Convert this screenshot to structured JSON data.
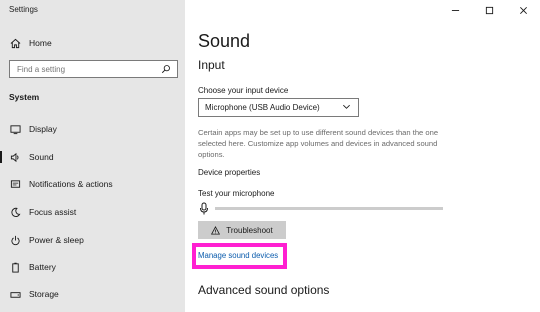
{
  "window": {
    "app_title": "Settings",
    "controls": [
      {
        "name": "minimize-icon"
      },
      {
        "name": "maximize-icon"
      },
      {
        "name": "close-icon"
      }
    ]
  },
  "sidebar": {
    "home_label": "Home",
    "search_placeholder": "Find a setting",
    "section_label": "System",
    "items": [
      {
        "label": "Display",
        "icon": "display-icon"
      },
      {
        "label": "Sound",
        "icon": "speaker-icon",
        "active": true
      },
      {
        "label": "Notifications & actions",
        "icon": "notifications-icon"
      },
      {
        "label": "Focus assist",
        "icon": "moon-icon"
      },
      {
        "label": "Power & sleep",
        "icon": "power-icon"
      },
      {
        "label": "Battery",
        "icon": "battery-icon"
      },
      {
        "label": "Storage",
        "icon": "storage-icon"
      }
    ]
  },
  "main": {
    "title": "Sound",
    "input_heading": "Input",
    "choose_label": "Choose your input device",
    "selected_device": "Microphone (USB Audio Device)",
    "description": "Certain apps may be set up to use different sound devices than the one selected here. Customize app volumes and devices in advanced sound options.",
    "device_properties_label": "Device properties",
    "test_label": "Test your microphone",
    "mic_level": 0,
    "troubleshoot_label": "Troubleshoot",
    "manage_link": "Manage sound devices",
    "advanced_heading": "Advanced sound options",
    "highlight_color": "#ff1fd1",
    "link_color": "#0b5cad"
  }
}
